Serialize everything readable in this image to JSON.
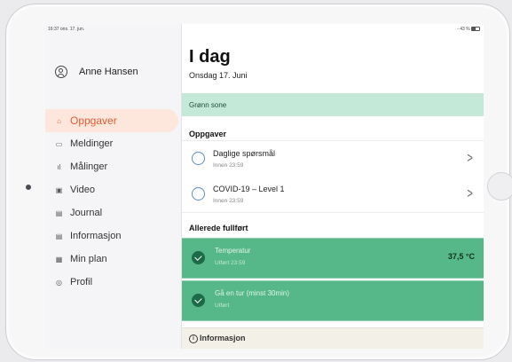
{
  "status": {
    "time": "16:37",
    "date": "ons. 17. jun.",
    "battery": "43 %"
  },
  "user": {
    "name": "Anne Hansen"
  },
  "nav": [
    {
      "label": "Oppgaver",
      "icon": "home-icon",
      "active": true
    },
    {
      "label": "Meldinger",
      "icon": "chat-icon"
    },
    {
      "label": "Målinger",
      "icon": "bar-chart-icon"
    },
    {
      "label": "Video",
      "icon": "video-icon"
    },
    {
      "label": "Journal",
      "icon": "clipboard-icon"
    },
    {
      "label": "Informasjon",
      "icon": "document-icon"
    },
    {
      "label": "Min plan",
      "icon": "calendar-icon"
    },
    {
      "label": "Profil",
      "icon": "profile-icon"
    }
  ],
  "main": {
    "title": "I dag",
    "subtitle": "Onsdag 17. Juni",
    "zone": "Grønn sone",
    "tasks_heading": "Oppgaver",
    "tasks": [
      {
        "title": "Daglige spørsmål",
        "deadline": "Innen 23:59"
      },
      {
        "title": "COVID-19 – Level 1",
        "deadline": "Innen 23:59"
      }
    ],
    "done_heading": "Allerede fullført",
    "done": [
      {
        "title": "Temperatur",
        "sub": "Utført 23:59",
        "value": "37,5 °C"
      },
      {
        "title": "Gå en tur (minst 30min)",
        "sub": "Utført",
        "value": ""
      }
    ],
    "info": "Informasjon"
  },
  "colors": {
    "accent": "#e25d34",
    "zone": "#c5e9d9",
    "done": "#56b888",
    "check": "#1c6a47"
  }
}
